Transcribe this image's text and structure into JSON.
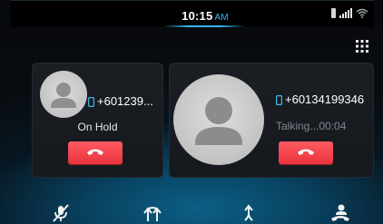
{
  "status_bar": {
    "time": "10:15",
    "ampm": "AM",
    "icons": [
      "battery-icon",
      "signal-icon",
      "wifi-icon"
    ]
  },
  "keypad": {
    "icon": "dialpad-icon"
  },
  "held_call": {
    "number": "+601239...",
    "status": "On Hold",
    "end_button_icon": "hang-up-icon"
  },
  "active_call": {
    "number": "+60134199346",
    "status": "Talking...00:04",
    "end_button_icon": "hang-up-icon"
  },
  "toolbar": {
    "items": [
      {
        "name": "mute",
        "icon": "mute-microphone-icon"
      },
      {
        "name": "merge",
        "icon": "merge-calls-icon"
      },
      {
        "name": "transfer",
        "icon": "transfer-call-icon"
      },
      {
        "name": "handset",
        "icon": "handset-icon"
      }
    ]
  },
  "colors": {
    "accent": "#39b4e6",
    "end_call": "#f0424b",
    "background": "#06090c"
  }
}
